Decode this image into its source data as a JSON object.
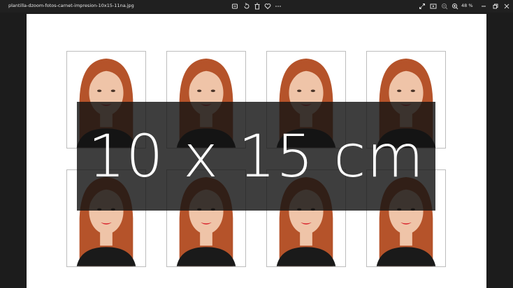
{
  "titlebar": {
    "filename": "plantilla-dzoom-fotos-carnet-impresion-10x15-11na.jpg",
    "zoom_level": "48 %",
    "toolbar_icons": [
      "crop-icon",
      "rotate-icon",
      "delete-icon",
      "favorite-icon",
      "more-icon"
    ],
    "right_icons": [
      "fullscreen-icon",
      "slideshow-icon",
      "zoom-out-icon",
      "zoom-in-icon",
      "minimize-icon",
      "restore-icon",
      "close-icon"
    ]
  },
  "image": {
    "overlay_text": "10 x 15 cm",
    "photo_count": 8,
    "colors": {
      "hair": "#b5532a",
      "skin": "#efc4a8",
      "lips": "#d8202a",
      "top": "#1a1a1a"
    }
  }
}
